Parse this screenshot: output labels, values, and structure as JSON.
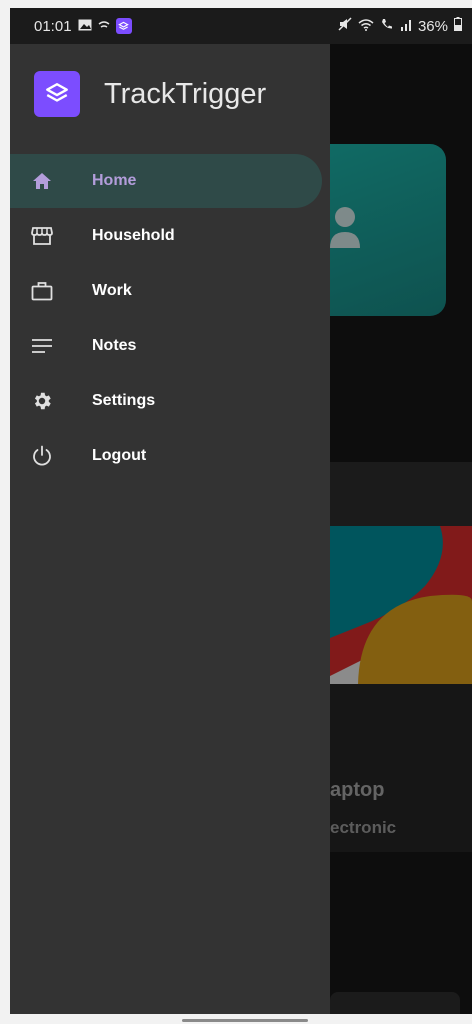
{
  "status": {
    "time": "01:01",
    "battery": "36%"
  },
  "app": {
    "title": "TrackTrigger"
  },
  "nav": {
    "items": [
      {
        "label": "Home",
        "icon": "home-icon",
        "active": true
      },
      {
        "label": "Household",
        "icon": "storefront-icon",
        "active": false
      },
      {
        "label": "Work",
        "icon": "briefcase-icon",
        "active": false
      },
      {
        "label": "Notes",
        "icon": "notes-icon",
        "active": false
      },
      {
        "label": "Settings",
        "icon": "gear-icon",
        "active": false
      },
      {
        "label": "Logout",
        "icon": "power-icon",
        "active": false
      }
    ]
  },
  "background": {
    "item_title": "aptop",
    "item_category": "ectronic"
  },
  "colors": {
    "accent": "#7c4dff",
    "active_bg": "#2f4a48",
    "active_text": "#b39ddb",
    "drawer_bg": "#333333"
  }
}
